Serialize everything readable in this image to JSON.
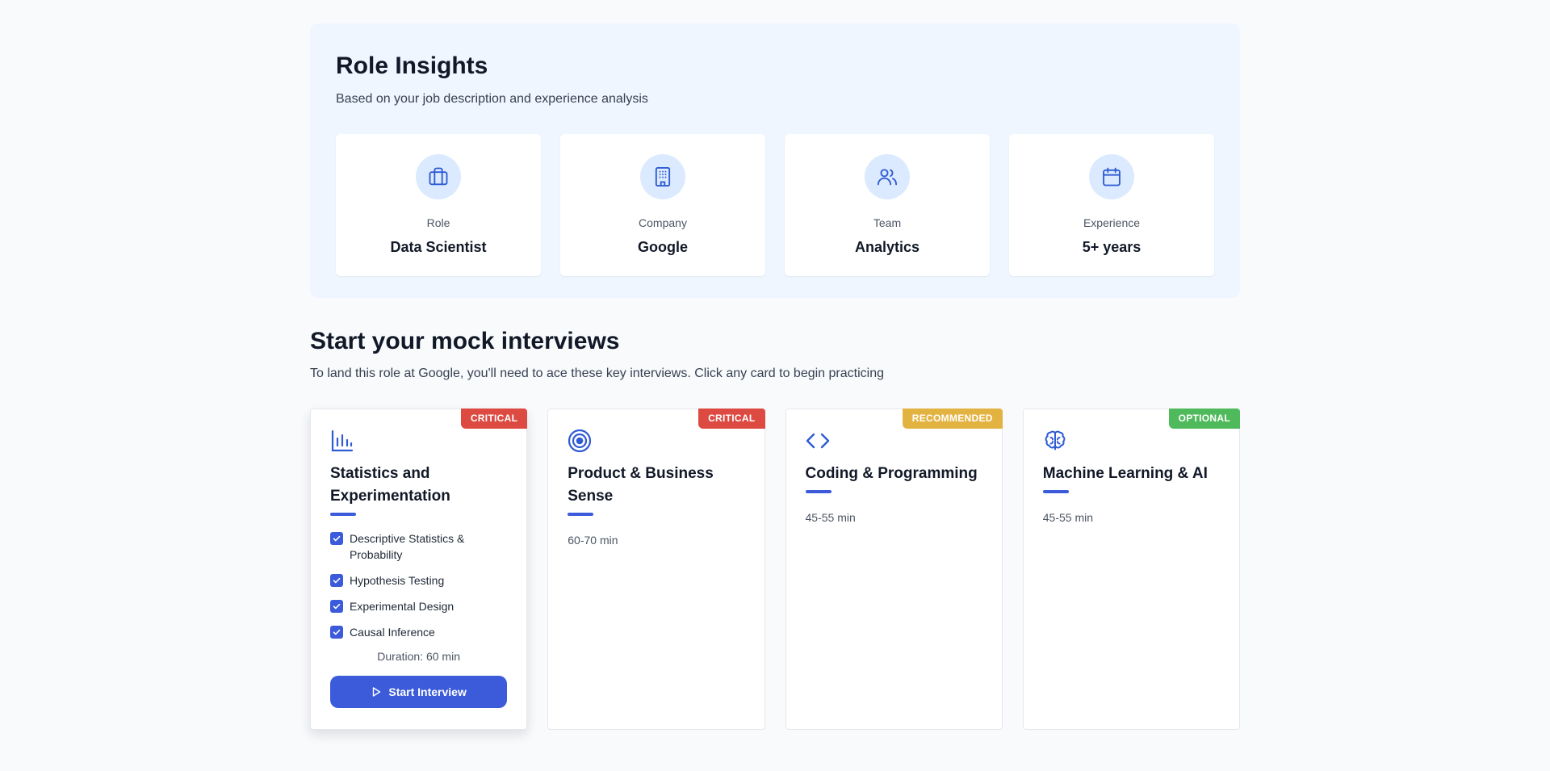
{
  "insights": {
    "title": "Role Insights",
    "subtitle": "Based on your job description and experience analysis",
    "cards": [
      {
        "label": "Role",
        "value": "Data Scientist",
        "icon": "briefcase-icon"
      },
      {
        "label": "Company",
        "value": "Google",
        "icon": "building-icon"
      },
      {
        "label": "Team",
        "value": "Analytics",
        "icon": "users-icon"
      },
      {
        "label": "Experience",
        "value": "5+ years",
        "icon": "calendar-icon"
      }
    ]
  },
  "mock": {
    "title": "Start your mock interviews",
    "subtitle": "To land this role at Google, you'll need to ace these key interviews. Click any card to begin practicing",
    "cards": [
      {
        "badge": "CRITICAL",
        "badge_color": "#dc4a41",
        "icon": "bar-chart-icon",
        "title": "Statistics and Experimentation",
        "topics": [
          "Descriptive Statistics & Probability",
          "Hypothesis Testing",
          "Experimental Design",
          "Causal Inference"
        ],
        "duration": "Duration: 60 min",
        "button": "Start Interview"
      },
      {
        "badge": "CRITICAL",
        "badge_color": "#dc4a41",
        "icon": "target-icon",
        "title": "Product & Business Sense",
        "duration": "60-70 min"
      },
      {
        "badge": "RECOMMENDED",
        "badge_color": "#e3b341",
        "icon": "code-icon",
        "title": "Coding & Programming",
        "duration": "45-55 min"
      },
      {
        "badge": "OPTIONAL",
        "badge_color": "#4fba5b",
        "icon": "brain-icon",
        "title": "Machine Learning & AI",
        "duration": "45-55 min"
      }
    ]
  },
  "colors": {
    "accent": "#3b5bdb",
    "panel": "#eff6ff",
    "icon_bg": "#dbeafe"
  }
}
